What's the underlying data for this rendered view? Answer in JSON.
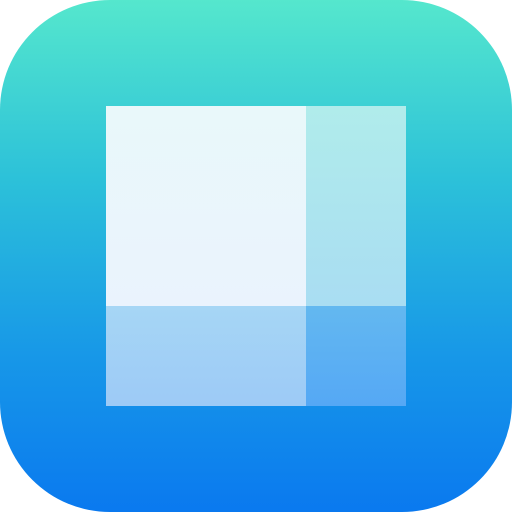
{
  "icon": {
    "name": "grid-layout-icon",
    "colors": {
      "gradient_top": "#55E7CD",
      "gradient_bottom": "#0A79EF",
      "tile_main": "#EAF5FB",
      "tile_right": "#ADE6EE",
      "tile_bottom": "#A1D0F6",
      "tile_corner": "#5BAFF3"
    }
  }
}
